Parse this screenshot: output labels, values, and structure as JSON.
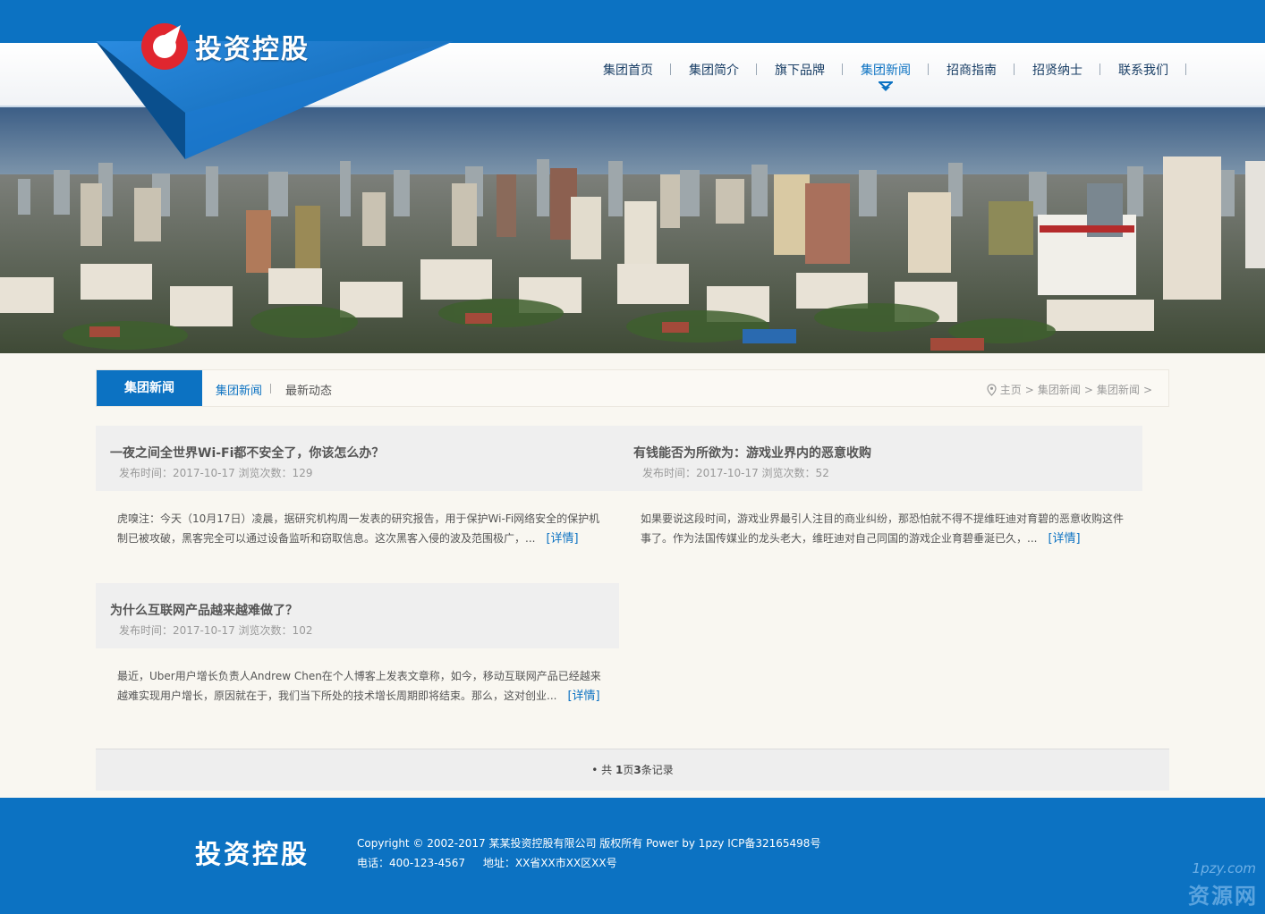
{
  "brand": {
    "name": "投资控股",
    "accent": "#0c72c2",
    "logo_red": "#e0262f"
  },
  "nav": {
    "items": [
      {
        "label": "集团首页"
      },
      {
        "label": "集团简介"
      },
      {
        "label": "旗下品牌"
      },
      {
        "label": "集团新闻"
      },
      {
        "label": "招商指南"
      },
      {
        "label": "招贤纳士"
      },
      {
        "label": "联系我们"
      }
    ],
    "active": "集团新闻"
  },
  "section": {
    "title": "集团新闻",
    "subtabs": [
      "集团新闻",
      "最新动态"
    ],
    "breadcrumb": [
      "主页",
      "集团新闻",
      "集团新闻"
    ]
  },
  "articles": [
    {
      "title": "一夜之间全世界Wi-Fi都不安全了，你该怎么办？",
      "meta": "发布时间：2017-10-17 浏览次数：129",
      "summary": "虎嗅注：今天（10月17日）凌晨，据研究机构周一发表的研究报告，用于保护Wi-Fi网络安全的保护机制已被攻破，黑客完全可以通过设备监听和窃取信息。这次黑客入侵的波及范围极广，...",
      "more": "[详情]"
    },
    {
      "title": "有钱能否为所欲为：游戏业界内的恶意收购",
      "meta": "发布时间：2017-10-17 浏览次数：52",
      "summary": "如果要说这段时间，游戏业界最引人注目的商业纠纷，那恐怕就不得不提维旺迪对育碧的恶意收购这件事了。作为法国传媒业的龙头老大，维旺迪对自己同国的游戏企业育碧垂涎已久，...",
      "more": "[详情]"
    },
    {
      "title": "为什么互联网产品越来越难做了？",
      "meta": "发布时间：2017-10-17 浏览次数：102",
      "summary": "最近，Uber用户增长负责人Andrew Chen在个人博客上发表文章称，如今，移动互联网产品已经越来越难实现用户增长，原因就在于，我们当下所处的技术增长周期即将结束。那么，这对创业...",
      "more": "[详情]"
    }
  ],
  "pager": {
    "prefix": "共 ",
    "pages": "1",
    "mid": "页",
    "records": "3",
    "suffix": "条记录"
  },
  "footer": {
    "copyright": "Copyright © 2002-2017 某某投资控股有限公司 版权所有 Power by 1pzy ICP备32165498号",
    "phone": "电话：400-123-4567",
    "address": "地址：XX省XX市XX区XX号"
  },
  "watermark": {
    "url": "1pzy.com",
    "text": "资源网"
  }
}
